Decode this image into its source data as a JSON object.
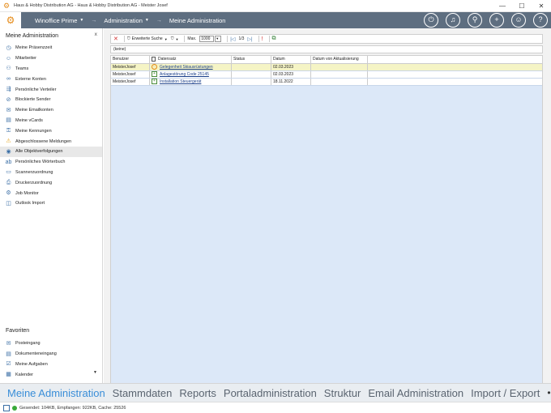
{
  "window": {
    "title": "Haus & Hobby Distribution AG - Haus & Hobby Distribution AG - Meister Josef",
    "controls": [
      "—",
      "☐",
      "✕"
    ]
  },
  "topnav": {
    "crumbs": [
      "Winoffice Prime",
      "Administration",
      "Meine Administration"
    ],
    "icons": [
      "power-icon",
      "bell-icon",
      "search-icon",
      "plus-icon",
      "user-icon",
      "help-icon"
    ]
  },
  "sidebar": {
    "title": "Meine Administration",
    "pin": "ⅹ",
    "items": [
      {
        "label": "Meine Präsenzzeit",
        "icon": "clock-icon"
      },
      {
        "label": "Mitarbeiter",
        "icon": "person-icon"
      },
      {
        "label": "Teams",
        "icon": "team-icon"
      },
      {
        "label": "Externe Konten",
        "icon": "link-icon"
      },
      {
        "label": "Persönliche Verteiler",
        "icon": "distribution-icon"
      },
      {
        "label": "Blockierte Sender",
        "icon": "blocked-user-icon"
      },
      {
        "label": "Meine Emailkonten",
        "icon": "mail-account-icon"
      },
      {
        "label": "Meine vCards",
        "icon": "vcard-icon"
      },
      {
        "label": "Meine Kennungen",
        "icon": "key-icon"
      },
      {
        "label": "Abgeschlossene Meldungen",
        "icon": "warning-icon"
      },
      {
        "label": "Alle Objektverfolgungen",
        "icon": "eye-icon"
      },
      {
        "label": "Persönliches Wörterbuch",
        "icon": "dictionary-icon"
      },
      {
        "label": "Scannerzuordnung",
        "icon": "scanner-icon"
      },
      {
        "label": "Druckerzuordnung",
        "icon": "printer-icon"
      },
      {
        "label": "Job Monitor",
        "icon": "gear-icon"
      },
      {
        "label": "Outlook Import",
        "icon": "outlook-icon"
      }
    ],
    "active_index": 10,
    "favorites_title": "Favoriten",
    "favorites": [
      {
        "label": "Posteingang",
        "icon": "inbox-icon"
      },
      {
        "label": "Dokumenteneingang",
        "icon": "document-inbox-icon"
      },
      {
        "label": "Meine Aufgaben",
        "icon": "tasks-icon"
      },
      {
        "label": "Kalender",
        "icon": "calendar-icon"
      }
    ]
  },
  "toolbar": {
    "filter_label": "Erweiterte Suche",
    "max_label": "Max.",
    "max_value": "1000",
    "page": "1/3"
  },
  "filter_text": "(keine)",
  "grid": {
    "columns": [
      "Benutzer",
      "Datensatz",
      "Status",
      "Datum",
      "Datum von Aktualisierung"
    ],
    "rows": [
      {
        "user": "MeisterJosef",
        "record": "Gelegenheit Skiausrüstungen",
        "status": "",
        "date": "02.03.2023",
        "updated": "",
        "icon": "opportunity-icon"
      },
      {
        "user": "MeisterJosef",
        "record": "Anlagestörung Code 25145",
        "status": "",
        "date": "02.03.2023",
        "updated": "",
        "icon": "incident-icon"
      },
      {
        "user": "MeisterJosef",
        "record": "Installation Steuergerät",
        "status": "",
        "date": "18.11.2022",
        "updated": "",
        "icon": "incident-icon"
      }
    ]
  },
  "bottom_tabs": [
    "Meine Administration",
    "Stammdaten",
    "Reports",
    "Portaladministration",
    "Struktur",
    "Email Administration",
    "Import / Export",
    "•••"
  ],
  "status": {
    "text": "Gesendet: 104KB, Empfangen: 922KB, Cache: 25526"
  },
  "colors": {
    "nav_bar": "#5e6e80",
    "accent": "#3a8ed8",
    "grid_background": "#dce8f8",
    "selected_row": "#f5f4c5"
  }
}
